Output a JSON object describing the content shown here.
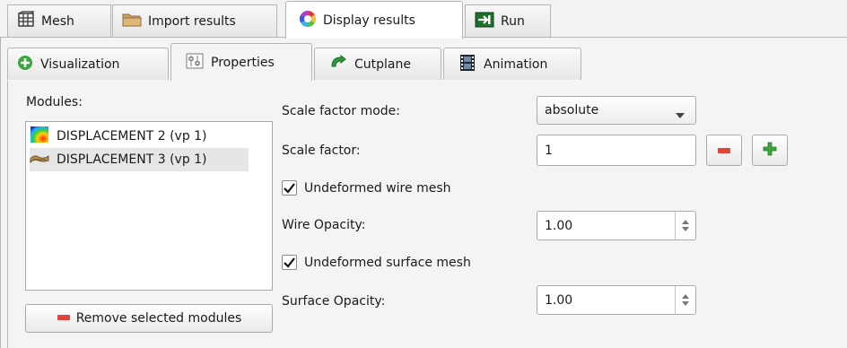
{
  "top_tabs": [
    {
      "label": "Mesh",
      "icon": "mesh-icon"
    },
    {
      "label": "Import results",
      "icon": "folder-icon"
    },
    {
      "label": "Display results",
      "icon": "color-wheel-icon"
    },
    {
      "label": "Run",
      "icon": "run-arrow-icon"
    }
  ],
  "sub_tabs": [
    {
      "label": "Visualization",
      "icon": "add-green-icon"
    },
    {
      "label": "Properties",
      "icon": "properties-icon"
    },
    {
      "label": "Cutplane",
      "icon": "cutplane-icon"
    },
    {
      "label": "Animation",
      "icon": "film-icon"
    }
  ],
  "modules": {
    "label": "Modules:",
    "items": [
      {
        "label": "DISPLACEMENT 2 (vp 1)",
        "icon": "contour-icon"
      },
      {
        "label": "DISPLACEMENT 3 (vp 1)",
        "icon": "deformed-shape-icon"
      }
    ],
    "remove_label": "Remove selected modules"
  },
  "properties": {
    "scale_mode_label": "Scale factor mode:",
    "scale_mode_value": "absolute",
    "scale_factor_label": "Scale factor:",
    "scale_factor_value": "1",
    "undeformed_wire_label": "Undeformed wire mesh",
    "wire_opacity_label": "Wire Opacity:",
    "wire_opacity_value": "1.00",
    "undeformed_surface_label": "Undeformed surface mesh",
    "surface_opacity_label": "Surface Opacity:",
    "surface_opacity_value": "1.00"
  },
  "colors": {
    "minus_red": "#e0443b",
    "plus_green": "#3aa53a"
  }
}
